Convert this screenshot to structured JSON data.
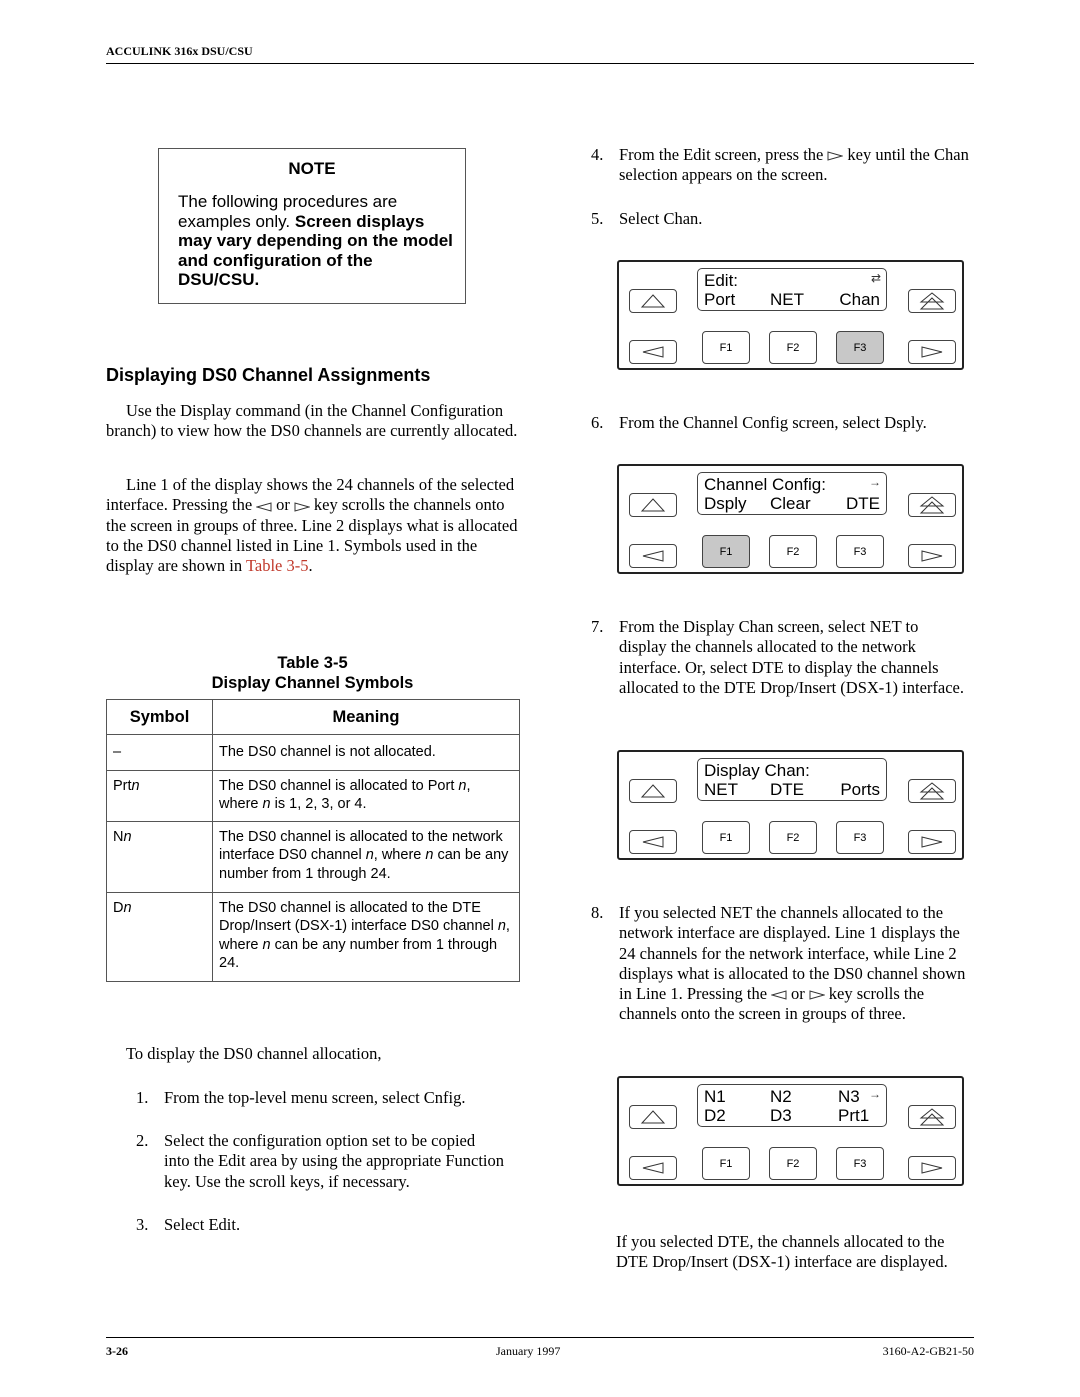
{
  "header": {
    "title": "ACCULINK 316x DSU/CSU"
  },
  "note": {
    "title": "NOTE",
    "body_plain": "The following procedures are examples only.",
    "body_bold": "Screen displays may vary depending on the model and configuration of the DSU/CSU."
  },
  "section": {
    "heading": "Displaying DS0 Channel Assignments",
    "para1": "Use the Display command (in the Channel Configuration branch) to view how the DS0 channels are currently allocated.",
    "para2_a": "Line 1 of the display shows the 24 channels of the selected interface. Pressing the",
    "para2_or": "or",
    "para2_b": "key scrolls the channels onto the screen in groups of three. Line 2 displays what is allocated to the DS0 channel listed in Line 1. Symbols used in the display are shown in",
    "para2_link": "Table 3-5",
    "para2_end": "."
  },
  "table": {
    "caption_number": "Table 3-5",
    "caption_title": "Display Channel Symbols",
    "headers": [
      "Symbol",
      "Meaning"
    ],
    "rows": [
      {
        "symbol_prefix": "–",
        "symbol_var": "",
        "meaning": "The DS0 channel is not allocated."
      },
      {
        "symbol_prefix": "Prt",
        "symbol_var": "n",
        "meaning": "The DS0 channel is allocated to Port n, where n is 1, 2, 3, or 4."
      },
      {
        "symbol_prefix": "N",
        "symbol_var": "n",
        "meaning": "The DS0 channel is allocated to the network interface DS0 channel n, where n can be any number from 1 through 24."
      },
      {
        "symbol_prefix": "D",
        "symbol_var": "n",
        "meaning": "The DS0 channel is allocated to the DTE Drop/Insert (DSX-1) interface DS0 channel n, where n can be any number from 1 through 24."
      }
    ]
  },
  "procedure": {
    "intro": "To display the DS0 channel allocation,",
    "steps": [
      {
        "num": "1.",
        "text": "From the top-level menu screen, select Cnfig."
      },
      {
        "num": "2.",
        "text": "Select the configuration option set to be copied into the Edit area by using the appropriate Function key. Use the scroll keys, if necessary."
      },
      {
        "num": "3.",
        "text": "Select Edit."
      },
      {
        "num": "4.",
        "text_a": "From the Edit screen, press the",
        "text_b": "key until the Chan selection appears on the screen."
      },
      {
        "num": "5.",
        "text": "Select Chan."
      },
      {
        "num": "6.",
        "text": "From the Channel Config screen, select Dsply."
      },
      {
        "num": "7.",
        "text": "From the Display Chan screen, select NET to display the channels allocated to the network interface. Or, select DTE to display the channels allocated to the DTE Drop/Insert (DSX-1) interface."
      },
      {
        "num": "8.",
        "text_a": "If you selected NET the channels allocated to the network interface are displayed. Line 1 displays the 24 channels for the network interface, while Line 2 displays what is allocated to the DS0 channel shown in Line 1. Pressing the",
        "text_or": "or",
        "text_b": "key scrolls the channels onto the screen in groups of three."
      }
    ],
    "closing": "If you selected DTE, the channels allocated to the DTE Drop/Insert (DSX-1) interface are displayed."
  },
  "panels": [
    {
      "line1": [
        "Edit:",
        "",
        ""
      ],
      "line2": [
        "Port",
        "NET",
        "Chan"
      ],
      "indicator": "⇄",
      "active_key": "F3",
      "keys": [
        "F1",
        "F2",
        "F3"
      ]
    },
    {
      "line1": [
        "Channel Config:",
        "",
        ""
      ],
      "line2": [
        "Dsply",
        "Clear",
        "DTE"
      ],
      "indicator": "→",
      "active_key": "F1",
      "keys": [
        "F1",
        "F2",
        "F3"
      ]
    },
    {
      "line1": [
        "Display Chan:",
        "",
        ""
      ],
      "line2": [
        "NET",
        "DTE",
        "Ports"
      ],
      "indicator": "",
      "active_key": "",
      "keys": [
        "F1",
        "F2",
        "F3"
      ]
    },
    {
      "line1": [
        "N1",
        "N2",
        "N3"
      ],
      "line2": [
        "D2",
        "D3",
        "Prt1"
      ],
      "indicator": "→",
      "active_key": "",
      "keys": [
        "F1",
        "F2",
        "F3"
      ]
    }
  ],
  "footer": {
    "page": "3-26",
    "date": "January 1997",
    "doc_id": "3160-A2-GB21-50"
  },
  "colors": {
    "link": "#c0392b",
    "active_key": "#c8c8c8"
  }
}
